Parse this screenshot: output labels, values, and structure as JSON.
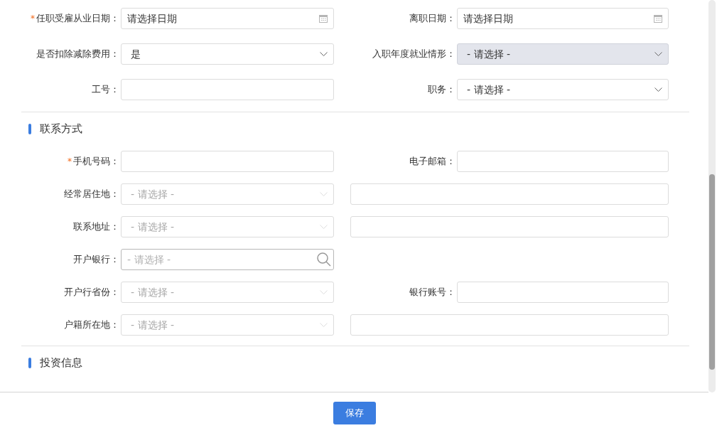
{
  "sections": [
    {
      "rows": [
        {
          "left": {
            "label": "任职受雇从业日期：",
            "required_mark": "*",
            "field": {
              "kind": "date",
              "placeholder": "请选择日期"
            }
          },
          "right": {
            "label": "离职日期：",
            "field": {
              "kind": "date",
              "placeholder": "请选择日期"
            }
          }
        },
        {
          "left": {
            "label": "是否扣除减除费用：",
            "field": {
              "kind": "select",
              "value": "是",
              "shaded": false,
              "disabled": false
            }
          },
          "right": {
            "label": "入职年度就业情形：",
            "field": {
              "kind": "select",
              "value": "- 请选择 -",
              "shaded": true,
              "disabled": false
            }
          }
        },
        {
          "left": {
            "label": "工号：",
            "field": {
              "kind": "text"
            }
          },
          "right": {
            "label": "职务：",
            "field": {
              "kind": "select",
              "value": "- 请选择 -",
              "shaded": false,
              "disabled": false
            }
          }
        }
      ]
    },
    {
      "title": "联系方式",
      "rows": [
        {
          "left": {
            "label": "手机号码：",
            "required_mark": "*",
            "field": {
              "kind": "text"
            }
          },
          "right": {
            "label": "电子邮箱：",
            "field": {
              "kind": "text"
            }
          }
        },
        {
          "left": {
            "label": "经常居住地：",
            "field": {
              "kind": "select",
              "placeholder": "- 请选择 -",
              "shaded": false,
              "disabled": true
            }
          },
          "right": {
            "field": {
              "kind": "text"
            }
          }
        },
        {
          "left": {
            "label": "联系地址：",
            "field": {
              "kind": "select",
              "placeholder": "- 请选择 -",
              "shaded": false,
              "disabled": true
            }
          },
          "right": {
            "field": {
              "kind": "text"
            }
          }
        },
        {
          "left": {
            "label": "开户银行：",
            "field": {
              "kind": "search",
              "placeholder": "- 请选择 -"
            }
          }
        },
        {
          "left": {
            "label": "开户行省份：",
            "field": {
              "kind": "select",
              "placeholder": "- 请选择 -",
              "shaded": false,
              "disabled": true
            }
          },
          "right": {
            "label": "银行账号：",
            "field": {
              "kind": "text"
            }
          }
        },
        {
          "left": {
            "label": "户籍所在地：",
            "field": {
              "kind": "select",
              "placeholder": "- 请选择 -",
              "shaded": false,
              "disabled": true
            }
          },
          "right": {
            "field": {
              "kind": "text"
            }
          }
        }
      ]
    },
    {
      "title": "投资信息"
    }
  ],
  "save_button": "保存"
}
